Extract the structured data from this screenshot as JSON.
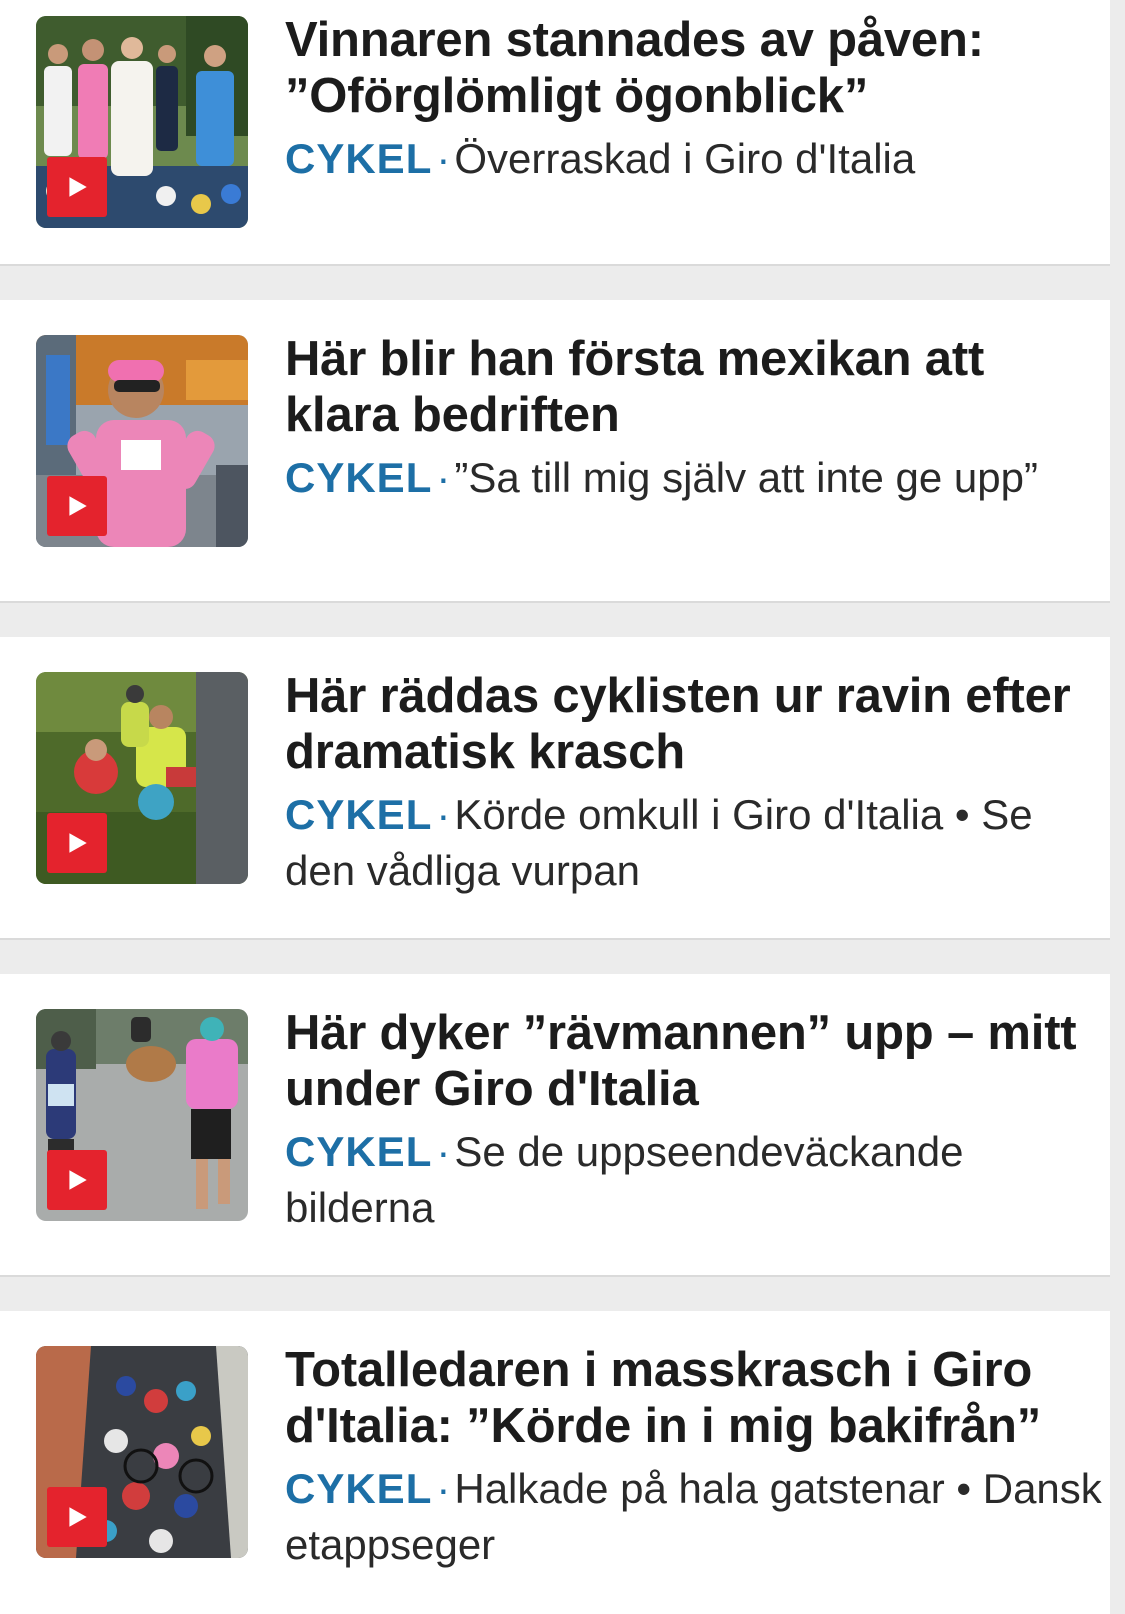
{
  "articles": [
    {
      "headline": "Vinnaren stannades av påven: ”Oförglömligt ögonblick”",
      "category": "CYKEL",
      "separator": "·",
      "subtitle": "Överraskad i Giro d'Italia",
      "thumbnail_icon": "pope-cyclists-photo",
      "has_video": true
    },
    {
      "headline": "Här blir han första mexikan att klara bedriften",
      "category": "CYKEL",
      "separator": "·",
      "subtitle": "”Sa till mig själv att inte ge upp”",
      "thumbnail_icon": "pink-jersey-cyclist-photo",
      "has_video": true
    },
    {
      "headline": "Här räddas cyklisten ur ravin efter dramatisk krasch",
      "category": "CYKEL",
      "separator": "·",
      "subtitle": "Körde omkull i Giro d'Italia • Se den vådliga vurpan",
      "thumbnail_icon": "ravine-rescue-photo",
      "has_video": true
    },
    {
      "headline": "Här dyker ”rävmannen” upp – mitt under Giro d'Italia",
      "category": "CYKEL",
      "separator": "·",
      "subtitle": "Se de uppseendeväckande bilderna",
      "thumbnail_icon": "fox-man-photo",
      "has_video": true
    },
    {
      "headline": "Totalledaren i masskrasch i Giro d'Italia: ”Körde in i mig bakifrån”",
      "category": "CYKEL",
      "separator": "·",
      "subtitle": "Halkade på hala gatstenar • Dansk etappseger",
      "thumbnail_icon": "mass-crash-photo",
      "has_video": true
    }
  ],
  "colors": {
    "category": "#1d6fa6",
    "play_badge": "#e4232d",
    "headline": "#1c1c1c",
    "background": "#ececec",
    "card": "#ffffff"
  }
}
